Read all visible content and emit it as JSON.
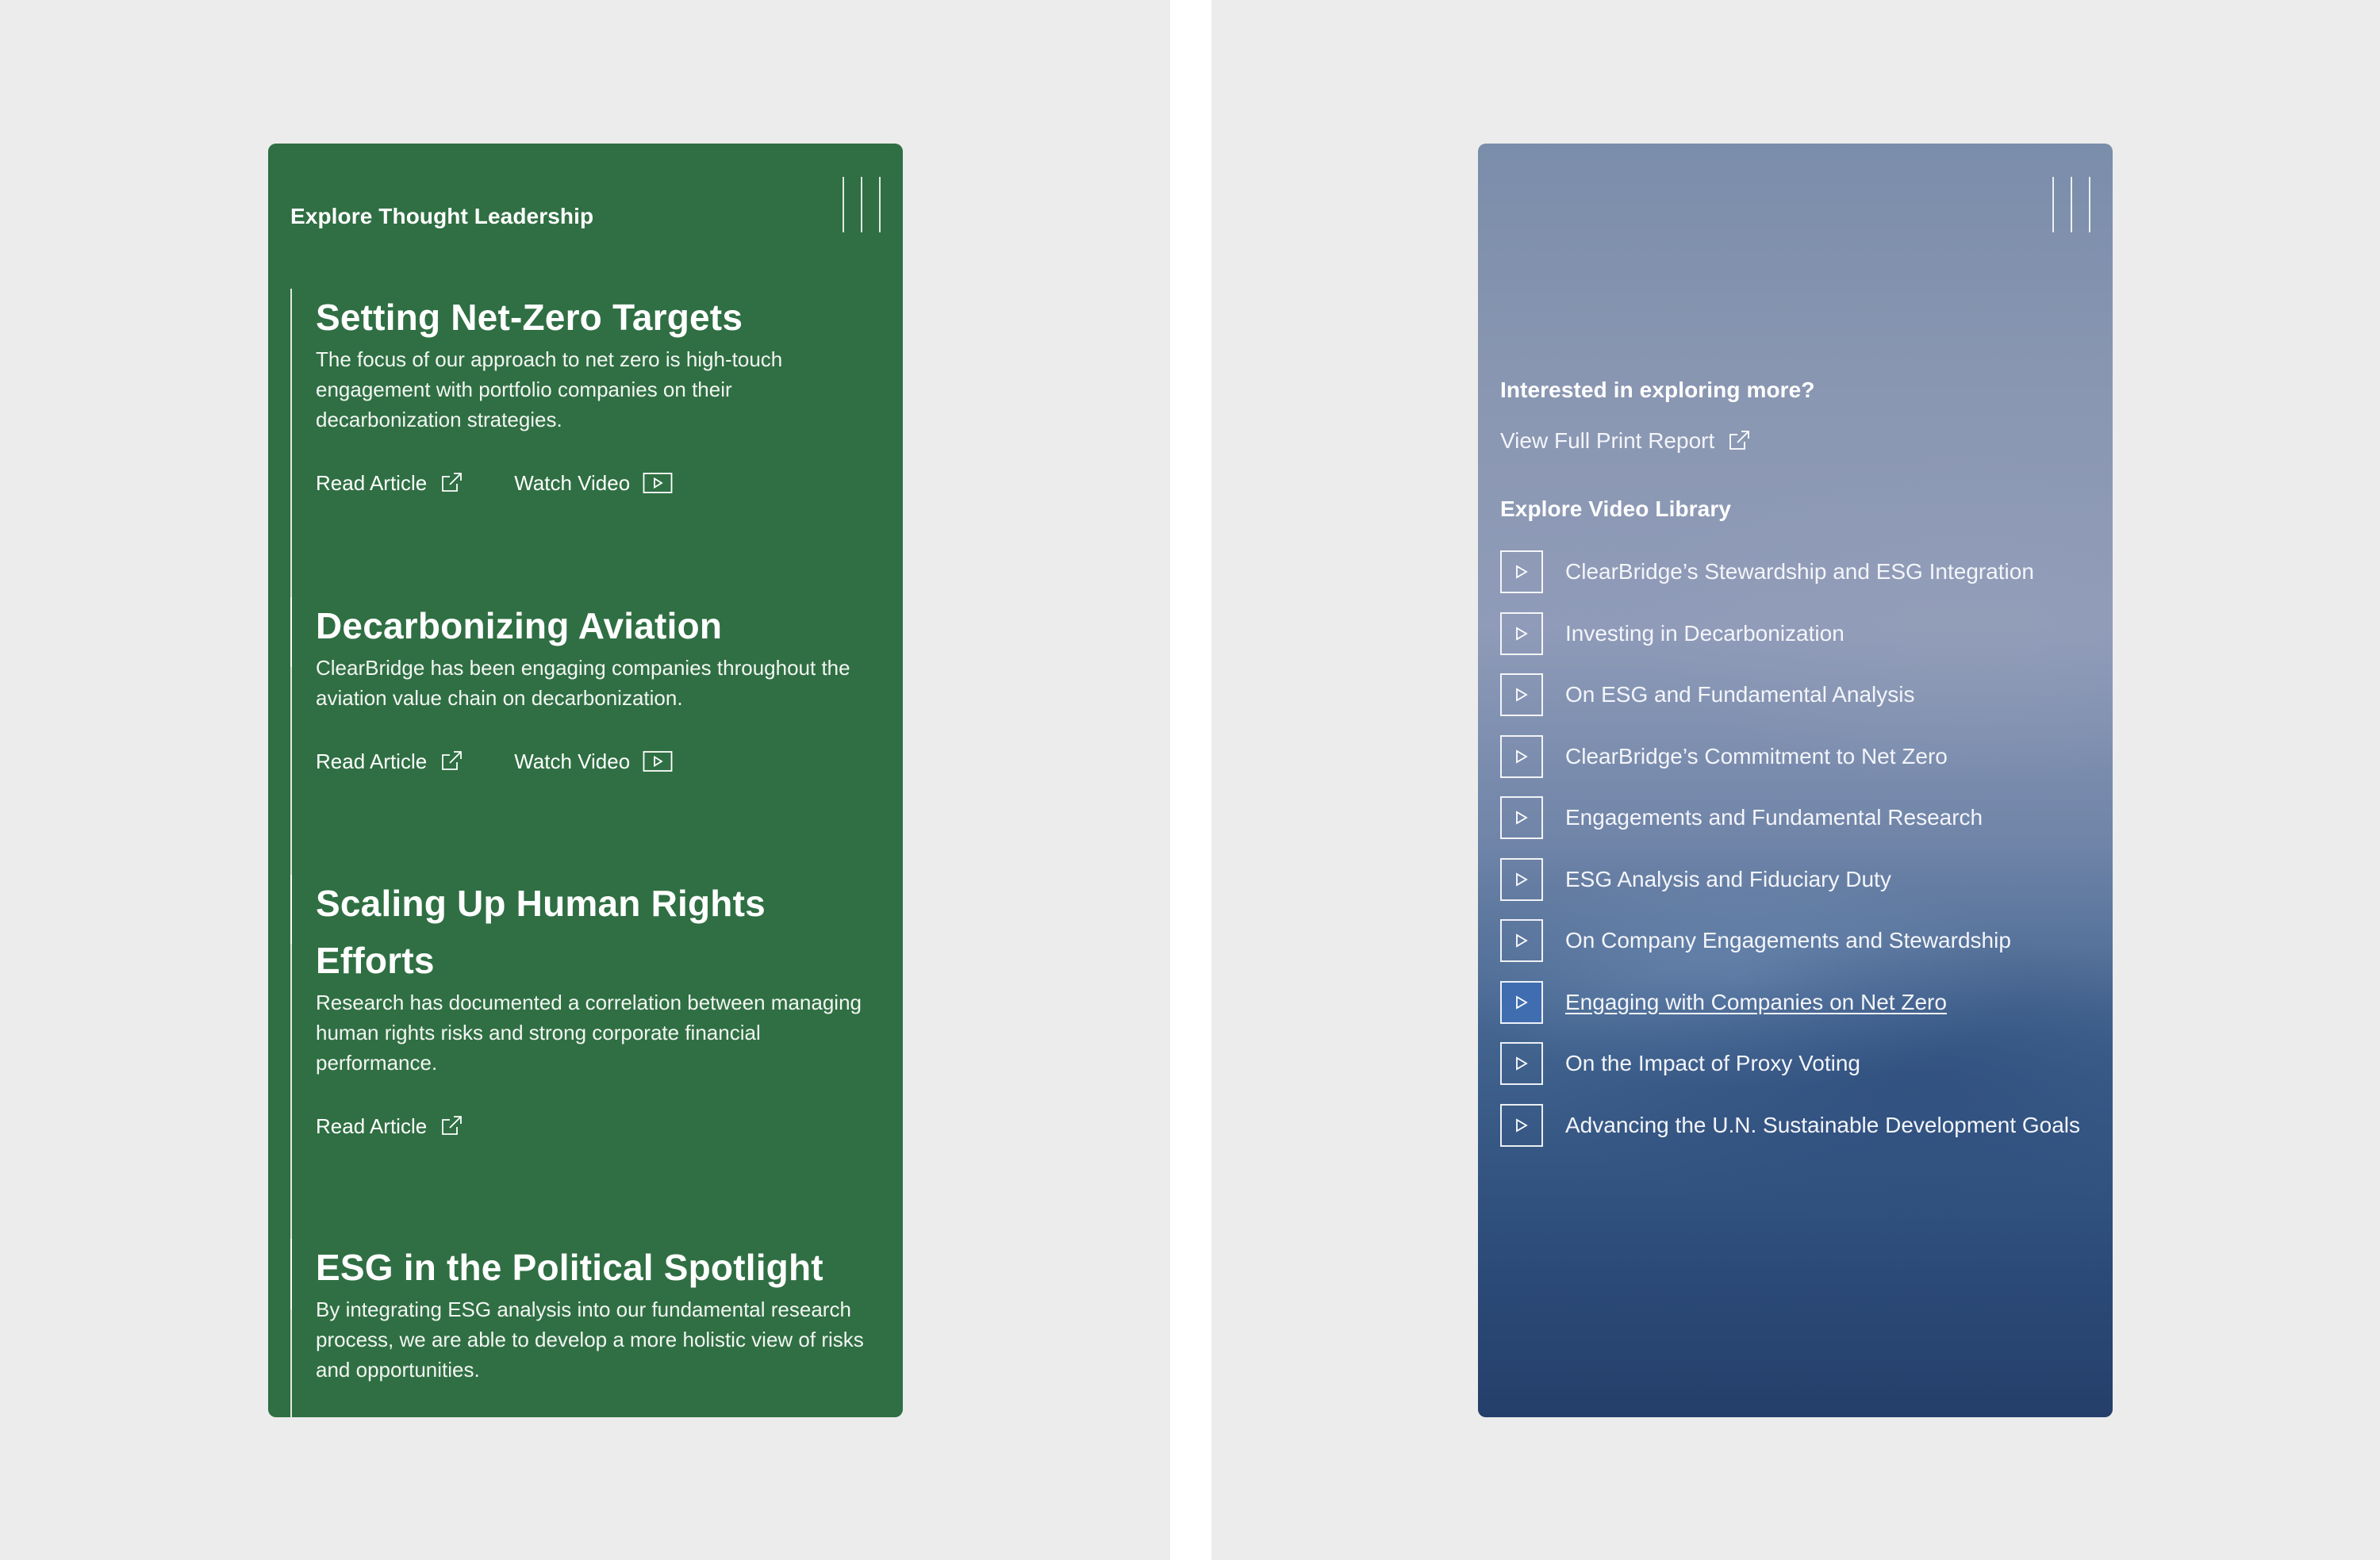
{
  "left_panel": {
    "heading": "Explore Thought Leadership",
    "articles": [
      {
        "title": "Setting Net-Zero Targets",
        "description": "The focus of our approach to net zero is high-touch engagement with portfolio companies on their decarbonization strategies.",
        "read_label": "Read Article",
        "video_label": "Watch Video"
      },
      {
        "title": "Decarbonizing Aviation",
        "description": "ClearBridge has been engaging companies throughout the aviation value chain on decarbonization.",
        "read_label": "Read Article",
        "video_label": "Watch Video"
      },
      {
        "title": "Scaling Up Human Rights Efforts",
        "description": "Research has documented a correlation between managing human rights risks and strong corporate financial performance.",
        "read_label": "Read Article"
      },
      {
        "title": "ESG in the Political Spotlight",
        "description": "By integrating ESG analysis into our fundamental research process, we are able to develop a more holistic view of risks and opportunities."
      }
    ]
  },
  "right_panel": {
    "explore_heading": "Interested in exploring more?",
    "report_link": "View Full Print Report",
    "video_heading": "Explore Video Library",
    "videos": [
      {
        "label": "ClearBridge’s Stewardship and ESG Integration",
        "active": false
      },
      {
        "label": "Investing in Decarbonization",
        "active": false
      },
      {
        "label": "On ESG and Fundamental Analysis",
        "active": false
      },
      {
        "label": "ClearBridge’s Commitment to Net Zero",
        "active": false
      },
      {
        "label": "Engagements and Fundamental Research",
        "active": false
      },
      {
        "label": "ESG Analysis and Fiduciary Duty",
        "active": false
      },
      {
        "label": "On Company Engagements and Stewardship",
        "active": false
      },
      {
        "label": "Engaging with Companies on Net Zero",
        "active": true
      },
      {
        "label": "On the Impact of Proxy Voting",
        "active": false
      },
      {
        "label": "Advancing the U.N. Sustainable Development Goals",
        "active": false
      }
    ]
  },
  "icons": {
    "menu": "menu-lines-icon",
    "external": "external-link-icon",
    "video": "play-icon"
  },
  "colors": {
    "page_background": "#ececec",
    "green_panel": "#2f6f43",
    "active_play_box": "#3f6db0",
    "text": "#ffffff"
  }
}
